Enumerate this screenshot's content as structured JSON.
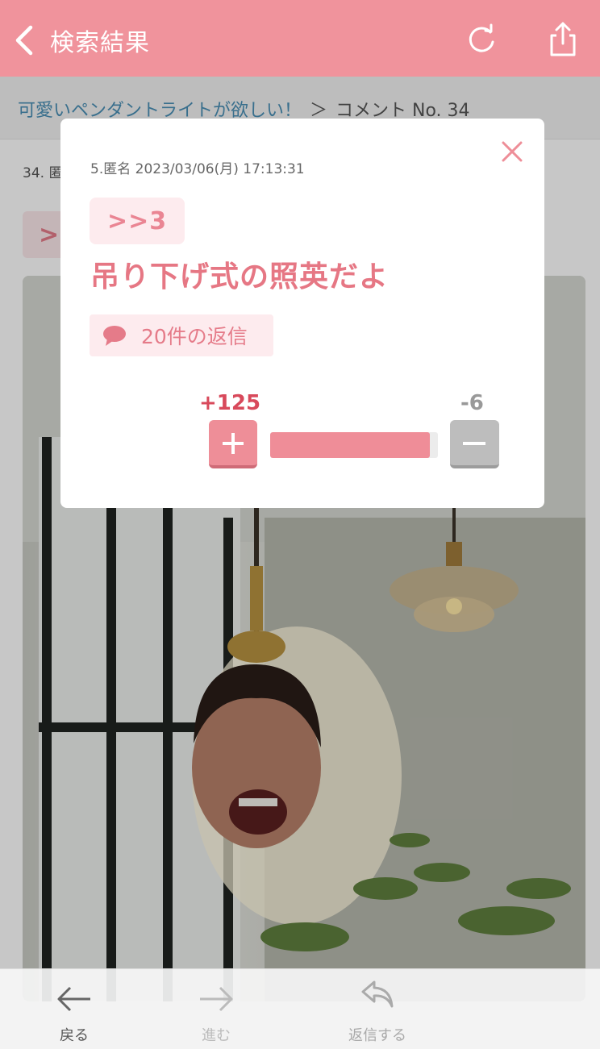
{
  "header": {
    "back_label": "検索結果",
    "colors": {
      "bar": "#f0939c"
    }
  },
  "breadcrumb": {
    "topic": "可愛いペンダントライトが欲しい！",
    "separator": "＞",
    "current": "コメント No. 34"
  },
  "background": {
    "comment_meta": "34. 匿",
    "anchor_partial": ">"
  },
  "modal": {
    "meta": "5.匿名 2023/03/06(月) 17:13:31",
    "reply_anchor": ">>3",
    "body": "吊り下げ式の照英だよ",
    "replies_label": "20件の返信",
    "plus_count": "+125",
    "minus_count": "-6",
    "vote_ratio": 0.954,
    "colors": {
      "accent": "#e67784",
      "plus": "#d8495b",
      "minus": "#999999"
    }
  },
  "toolbar": {
    "back_label": "戻る",
    "forward_label": "進む",
    "reply_label": "返信する"
  }
}
